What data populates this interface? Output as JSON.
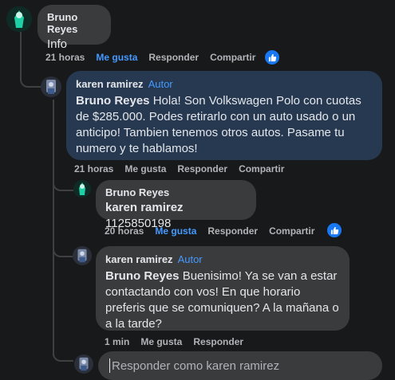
{
  "colors": {
    "background": "#18191a",
    "bubble": "#3a3b3c",
    "author_bubble": "#263951",
    "accent": "#4599ff",
    "muted": "#b0b3b8"
  },
  "comments": [
    {
      "author": "Bruno Reyes",
      "text": "Info",
      "time": "21 horas",
      "like_label": "Me gusta",
      "reply_label": "Responder",
      "share_label": "Compartir",
      "liked": true,
      "reaction_icon": "thumbs-up-icon"
    },
    {
      "author": "karen ramirez",
      "badge": "Autor",
      "tag": "Bruno Reyes",
      "text": "Hola! Son Volkswagen Polo con cuotas de $285.000. Podes retirarlo con un auto usado o un anticipo! Tambien tenemos otros autos. Pasame tu numero y te hablamos!",
      "time": "21 horas",
      "like_label": "Me gusta",
      "reply_label": "Responder",
      "share_label": "Compartir"
    },
    {
      "author": "Bruno Reyes",
      "tag": "karen ramirez",
      "text": "1125850198",
      "time": "20 horas",
      "like_label": "Me gusta",
      "reply_label": "Responder",
      "share_label": "Compartir",
      "liked": true,
      "reaction_icon": "thumbs-up-icon"
    },
    {
      "author": "karen ramirez",
      "badge": "Autor",
      "tag": "Bruno Reyes",
      "text": "Buenisimo! Ya se van a estar contactando con vos! En que horario preferis que se comuniquen? A la mañana o a la tarde?",
      "time": "1 min",
      "like_label": "Me gusta",
      "reply_label": "Responder"
    }
  ],
  "reply_box": {
    "placeholder": "Responder como karen ramirez"
  }
}
